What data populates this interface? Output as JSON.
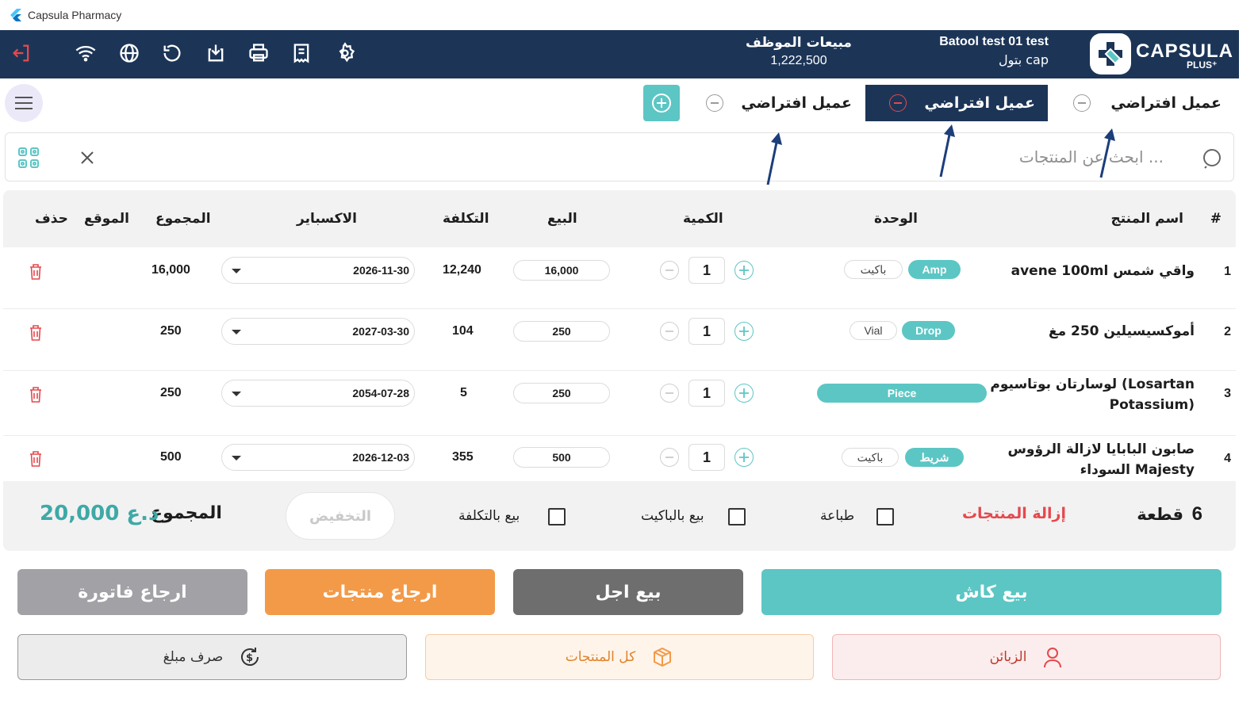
{
  "window": {
    "title": "Capsula Pharmacy"
  },
  "header": {
    "employee_sales_label": "مبيعات الموظف",
    "employee_sales_value": "1,222,500",
    "user_name": "Batool test 01 test",
    "user_sub": "بتول cap",
    "brand_word": "CAPSULA",
    "brand_plus": "PLUS⁺",
    "icons": [
      "logout-icon",
      "wifi-icon",
      "globe-icon",
      "refresh-icon",
      "download-icon",
      "printer-icon",
      "receipt-icon",
      "settings-icon"
    ]
  },
  "tabs": [
    {
      "label": "عميل افتراضي",
      "active": false
    },
    {
      "label": "عميل افتراضي",
      "active": true
    },
    {
      "label": "عميل افتراضي",
      "active": false
    }
  ],
  "search": {
    "placeholder": "ابحث عن المنتجات ..."
  },
  "table": {
    "headers": {
      "index": "#",
      "name": "اسم المنتج",
      "unit": "الوحدة",
      "qty": "الكمية",
      "sell": "البيع",
      "cost": "التكلفة",
      "expiry": "الاكسباير",
      "total": "المجموع",
      "location": "الموقع",
      "delete": "حذف"
    },
    "rows": [
      {
        "index": "1",
        "name": "avene 100ml واقي شمس",
        "unit_primary": "Amp",
        "unit_secondary": "باكيت",
        "qty": "1",
        "sell": "16,000",
        "cost": "12,240",
        "expiry": "2026-11-30",
        "total": "16,000"
      },
      {
        "index": "2",
        "name": "أموكسيسيلين 250 مغ",
        "unit_primary": "Drop",
        "unit_secondary": "Vial",
        "qty": "1",
        "sell": "250",
        "cost": "104",
        "expiry": "2027-03-30",
        "total": "250"
      },
      {
        "index": "3",
        "name": "لوسارتان بوتاسيوم (Losartan Potassium)",
        "unit_primary": "Piece",
        "unit_secondary": "",
        "qty": "1",
        "sell": "250",
        "cost": "5",
        "expiry": "2054-07-28",
        "total": "250"
      },
      {
        "index": "4",
        "name": "صابون البابايا لازالة الرؤوس السوداء Majesty",
        "unit_primary": "شريط",
        "unit_secondary": "باكيت",
        "qty": "1",
        "sell": "500",
        "cost": "355",
        "expiry": "2026-12-03",
        "total": "500"
      }
    ]
  },
  "summary": {
    "pieces_count": "6",
    "pieces_label": "قطعة",
    "remove_products": "إزالة المنتجات",
    "print_label": "طباعة",
    "sell_by_packet": "بيع بالباكيت",
    "sell_by_cost": "بيع بالتكلفة",
    "discount": "التخفيض",
    "total_label": "المجموع",
    "total_value": "20,000 د.ع"
  },
  "actions": {
    "cash_sale": "بيع كاش",
    "credit_sale": "بيع اجل",
    "return_products": "ارجاع منتجات",
    "return_invoice": "ارجاع فاتورة",
    "customers": "الزبائن",
    "all_products": "كل المنتجات",
    "spend_amount": "صرف مبلغ"
  },
  "colors": {
    "navy": "#1c3557",
    "teal": "#5cc6c4",
    "orange": "#f39a48",
    "dark_gray": "#6e6e6e",
    "gray": "#a1a1a6",
    "red": "#e5484d"
  }
}
